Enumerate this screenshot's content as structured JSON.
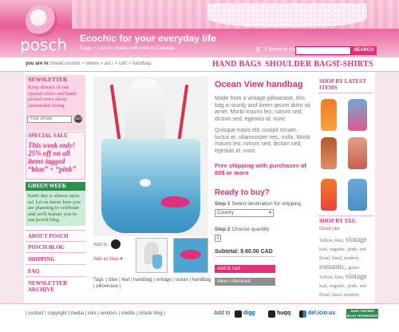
{
  "header": {
    "logo": "posch",
    "tagline": "Ecochic for your everyday life",
    "subtitle": "Bags + t-shirts made with love in Canada",
    "cart": "3 items in cart",
    "search_button": "SEARCH"
  },
  "breadcrumb": {
    "label": "you are in:",
    "path": "bread crumbs  >  where  >  am i  >  cart  >  handbag"
  },
  "top_nav": [
    "HAND BAGS",
    "SHOULDER BAGS",
    "T-SHIRTS"
  ],
  "newsletter": {
    "title": "NEWSLETTER",
    "text": "Keep abreast of our special offers and hand picked news about sustainable living",
    "email_placeholder": "Your email",
    "go": "GO"
  },
  "special_sale": {
    "title": "SPECIAL SALE",
    "text": "This week only! 25% off on all items tagged “blue” + “pink”"
  },
  "green_week": {
    "title": "GREEN WEEK",
    "text": "Earth day is almost upon us! Let us know how you are planning to celebrate and we'll feature you in our posch blog."
  },
  "side_links": [
    "ABOUT POSCH",
    "POSCH BLOG",
    "SHIPPING",
    "FAQ",
    "NEWSLETTER ARCHIVE"
  ],
  "product": {
    "title": "Ocean View handbag",
    "description": "Made from a vintage pillowcase, this bag is sturdy and lorem ipsum dolor sit amet. Morbi mauris leo, rutrum sed, dictum sed, egestas id, nunc",
    "description2": "Quisque turpis elit, susipit ornare, luctus et, ullamcorper nec, nulla. Morbi mauris leo, rutrum sed, dictum sed, egestas id, nunc",
    "shipping": "Free shipping with purchases of 80$ or more",
    "ready": "Ready to buy?",
    "step1_label": "Step 1",
    "step1_text": "Select destination for shipping",
    "country": "Country",
    "step2_label": "Step 2",
    "step2_text": "Choose quantity",
    "quantity": "1",
    "subtotal": "Subtotal: $ 60.00 CAD",
    "add_to_cart": "Add to cart",
    "view_checkout": "View / checkout",
    "add_to": "Add to:",
    "add_as_fave": "Add as fave",
    "tags": "Tags: | blue | leaf | handbag | vintage | ocean | handbag | pillowcase |"
  },
  "right_sidebar": {
    "latest_title": "SHOP BY LATEST ITEMS",
    "tag_title": "SHOP BY TAG",
    "tag_sub": "Cloud | list",
    "tag_cloud": [
      {
        "t": "Yellow,",
        "s": 6
      },
      {
        "t": "blue,",
        "s": 6
      },
      {
        "t": "vintage",
        "s": 9
      },
      {
        "t": "leaf,",
        "s": 6.5
      },
      {
        "t": "organic,",
        "s": 6.5
      },
      {
        "t": "pink,",
        "s": 6.5
      },
      {
        "t": "red",
        "s": 6.5
      },
      {
        "t": "floral,",
        "s": 6
      },
      {
        "t": "lined,",
        "s": 6
      },
      {
        "t": "modern,",
        "s": 6
      },
      {
        "t": "romantic,",
        "s": 9
      },
      {
        "t": "green",
        "s": 6
      },
      {
        "t": "Yellow,",
        "s": 6
      },
      {
        "t": "blue,",
        "s": 6
      },
      {
        "t": "vintage",
        "s": 9
      },
      {
        "t": "leaf,",
        "s": 6.5
      },
      {
        "t": "organic,",
        "s": 6.5
      },
      {
        "t": "pink,",
        "s": 6.5
      },
      {
        "t": "red",
        "s": 6.5
      },
      {
        "t": "floral,",
        "s": 6
      },
      {
        "t": "lined,",
        "s": 6
      },
      {
        "t": "modern,",
        "s": 6
      }
    ]
  },
  "footer": {
    "links": "| contact  | copyright  | media  | inks  | vendors  | credits  | Article blog  |",
    "add_to": "Add to",
    "digg": "digg",
    "huqq": "huqq",
    "delicious": "del.icio.us",
    "badge": "SAVE THE BEE BLOG TECHNORATI"
  },
  "colors": {
    "accent": "#e0307a",
    "green": "#2e8f4e",
    "background": "#f6e7ef"
  }
}
